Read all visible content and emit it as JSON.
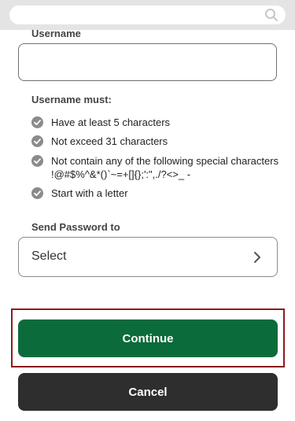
{
  "search": {
    "icon": "search-icon"
  },
  "username": {
    "label": "Username",
    "value": ""
  },
  "rules": {
    "heading": "Username must:",
    "items": [
      {
        "text": "Have at least 5 characters",
        "sub": ""
      },
      {
        "text": "Not exceed 31 characters",
        "sub": ""
      },
      {
        "text": "Not contain any of the following special characters",
        "sub": "!@#$%^&*()`~=+[]{};':\",./?<>_ -"
      },
      {
        "text": "Start with a letter",
        "sub": ""
      }
    ]
  },
  "send_password": {
    "label": "Send Password to",
    "selected": "Select"
  },
  "buttons": {
    "continue_label": "Continue",
    "cancel_label": "Cancel"
  },
  "colors": {
    "primary": "#0b6b3b",
    "secondary": "#2e2e2e",
    "highlight": "#8b1c1c"
  }
}
